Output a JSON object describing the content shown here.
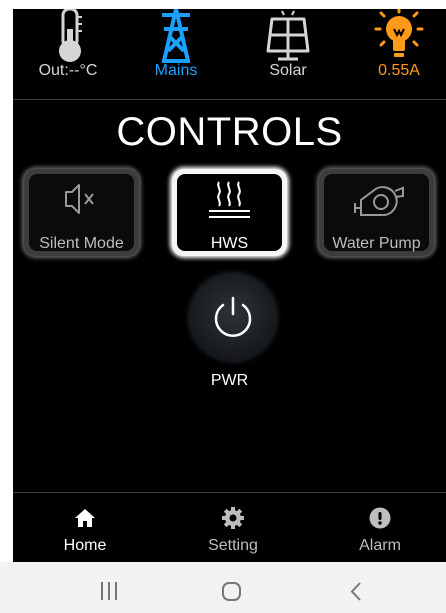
{
  "status_bar": {
    "temperature": {
      "label": "Out:--°C",
      "icon": "thermometer-icon"
    },
    "mains": {
      "label": "Mains",
      "icon": "power-tower-icon",
      "color": "#1aa0ff"
    },
    "solar": {
      "label": "Solar",
      "icon": "solar-panel-icon"
    },
    "current": {
      "label": "0.55A",
      "icon": "lightbulb-icon",
      "color": "#ff9a1a"
    }
  },
  "page_title": "CONTROLS",
  "controls": [
    {
      "label": "Silent Mode",
      "icon": "speaker-muted-icon",
      "active": false
    },
    {
      "label": "HWS",
      "icon": "hot-water-icon",
      "active": true
    },
    {
      "label": "Water Pump",
      "icon": "water-pump-icon",
      "active": false
    }
  ],
  "power_button": {
    "label": "PWR",
    "icon": "power-icon"
  },
  "tab_bar": {
    "tabs": [
      {
        "label": "Home",
        "icon": "home-icon",
        "active": true
      },
      {
        "label": "Setting",
        "icon": "gear-icon",
        "active": false
      },
      {
        "label": "Alarm",
        "icon": "alert-icon",
        "active": false
      }
    ]
  },
  "system_nav": {
    "buttons": [
      "recents-icon",
      "home-circle-icon",
      "back-icon"
    ]
  }
}
